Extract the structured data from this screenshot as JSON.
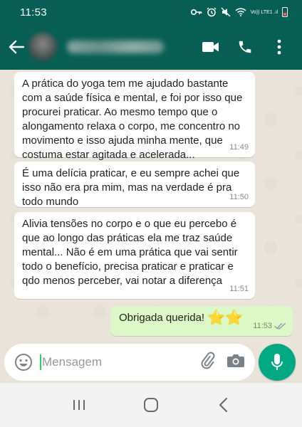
{
  "status_bar": {
    "time": "11:53",
    "network": "Vo)) LTE1 .ıl"
  },
  "header": {
    "actions": [
      "video-call-icon",
      "voice-call-icon",
      "more-options-icon"
    ]
  },
  "messages": [
    {
      "direction": "in",
      "text": "A prática do yoga tem me ajudado bastante com a saúde física e mental, e foi por isso que procurei praticar. Ao mesmo tempo que o alongamento relaxa o corpo, me concentro no movimento e isso ajuda minha mente, que costuma estar agitada e acelerada...",
      "time": "11:49"
    },
    {
      "direction": "in",
      "text": "É uma delícia praticar, e eu sempre achei que isso não era pra mim, mas na verdade é pra todo mundo",
      "time": "11:50"
    },
    {
      "direction": "in",
      "text": "Alivia tensões no corpo e o que eu percebo é que ao longo das práticas ela me traz saúde mental... Não é em uma prática que vai sentir todo o benefício, precisa praticar e praticar e qdo menos perceber, vai notar a diferença",
      "time": "11:51"
    },
    {
      "direction": "out",
      "text": "Obrigada querida!",
      "emoji": "⭐⭐",
      "time": "11:53",
      "status": "read"
    }
  ],
  "composer": {
    "placeholder": "Mensagem"
  },
  "nav": [
    "recent-apps-icon",
    "home-icon",
    "back-icon"
  ],
  "colors": {
    "header": "#075e54",
    "outgoing": "#dcf8c6",
    "incoming": "#ffffff",
    "accent": "#00a884"
  }
}
